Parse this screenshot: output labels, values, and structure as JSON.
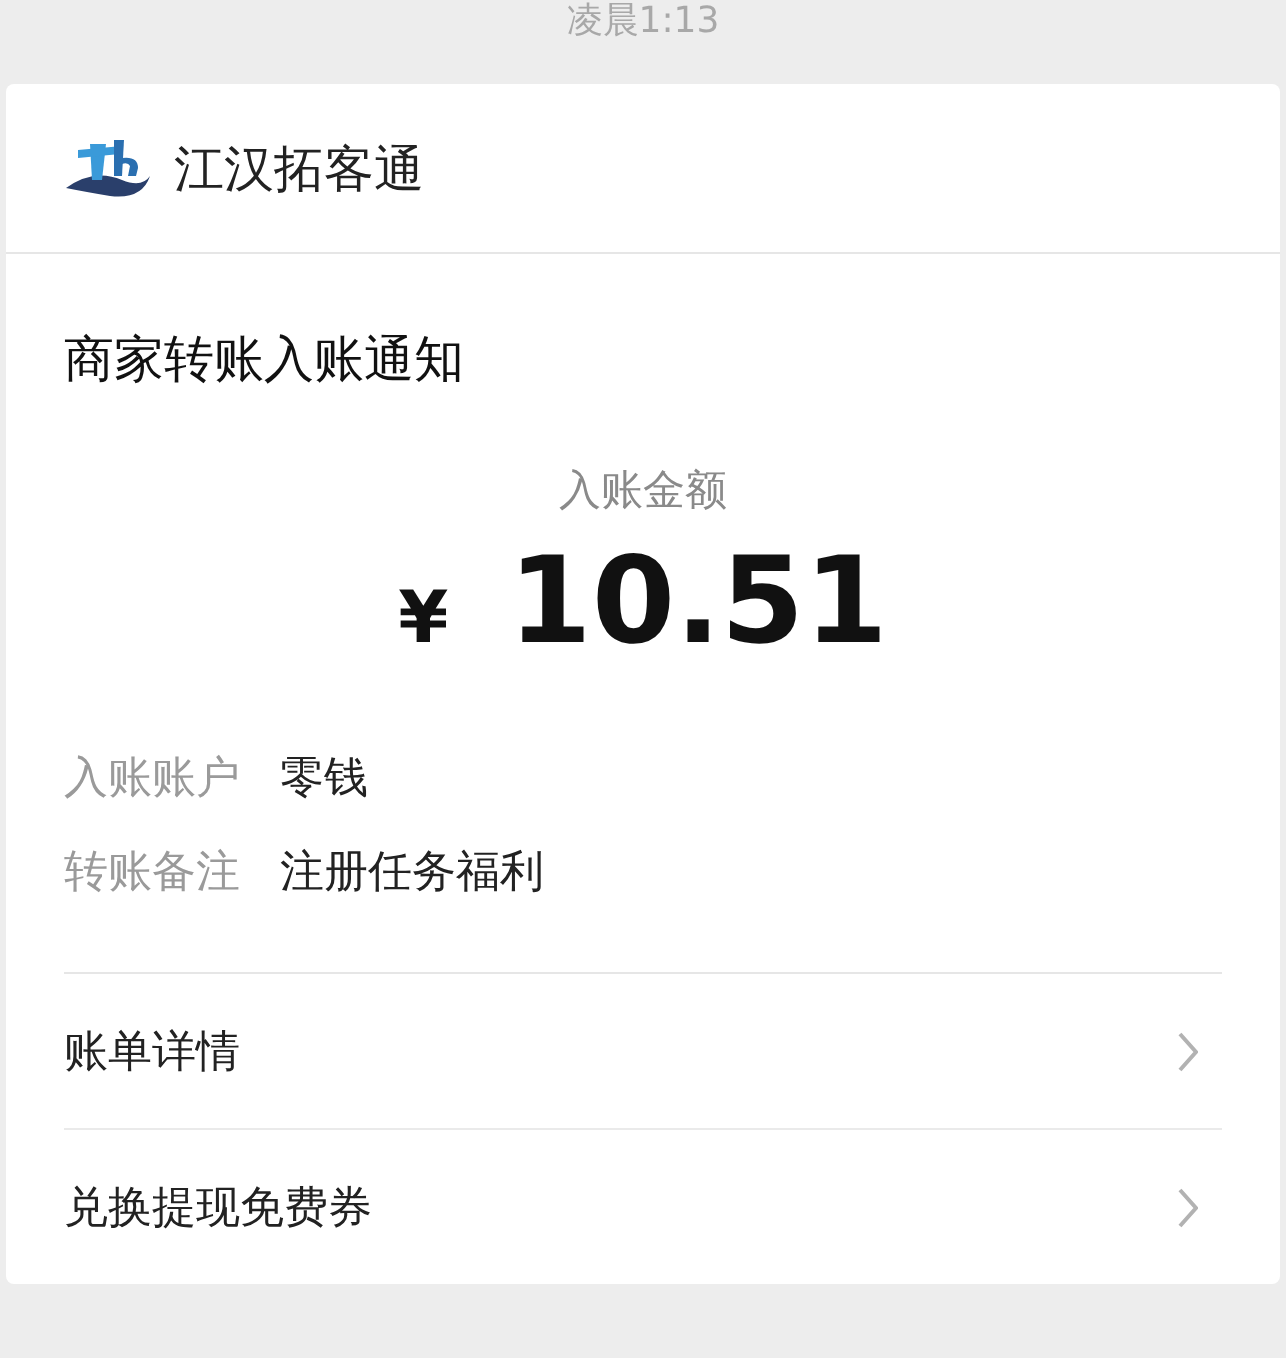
{
  "time": "凌晨1:13",
  "card": {
    "account_name": "江汉拓客通",
    "title": "商家转账入账通知",
    "amount_label": "入账金额",
    "currency": "¥",
    "amount": "10.51",
    "details": [
      {
        "label": "入账账户",
        "value": "零钱"
      },
      {
        "label": "转账备注",
        "value": "注册任务福利"
      }
    ],
    "links": [
      {
        "label": "账单详情"
      },
      {
        "label": "兑换提现免费券"
      }
    ]
  }
}
